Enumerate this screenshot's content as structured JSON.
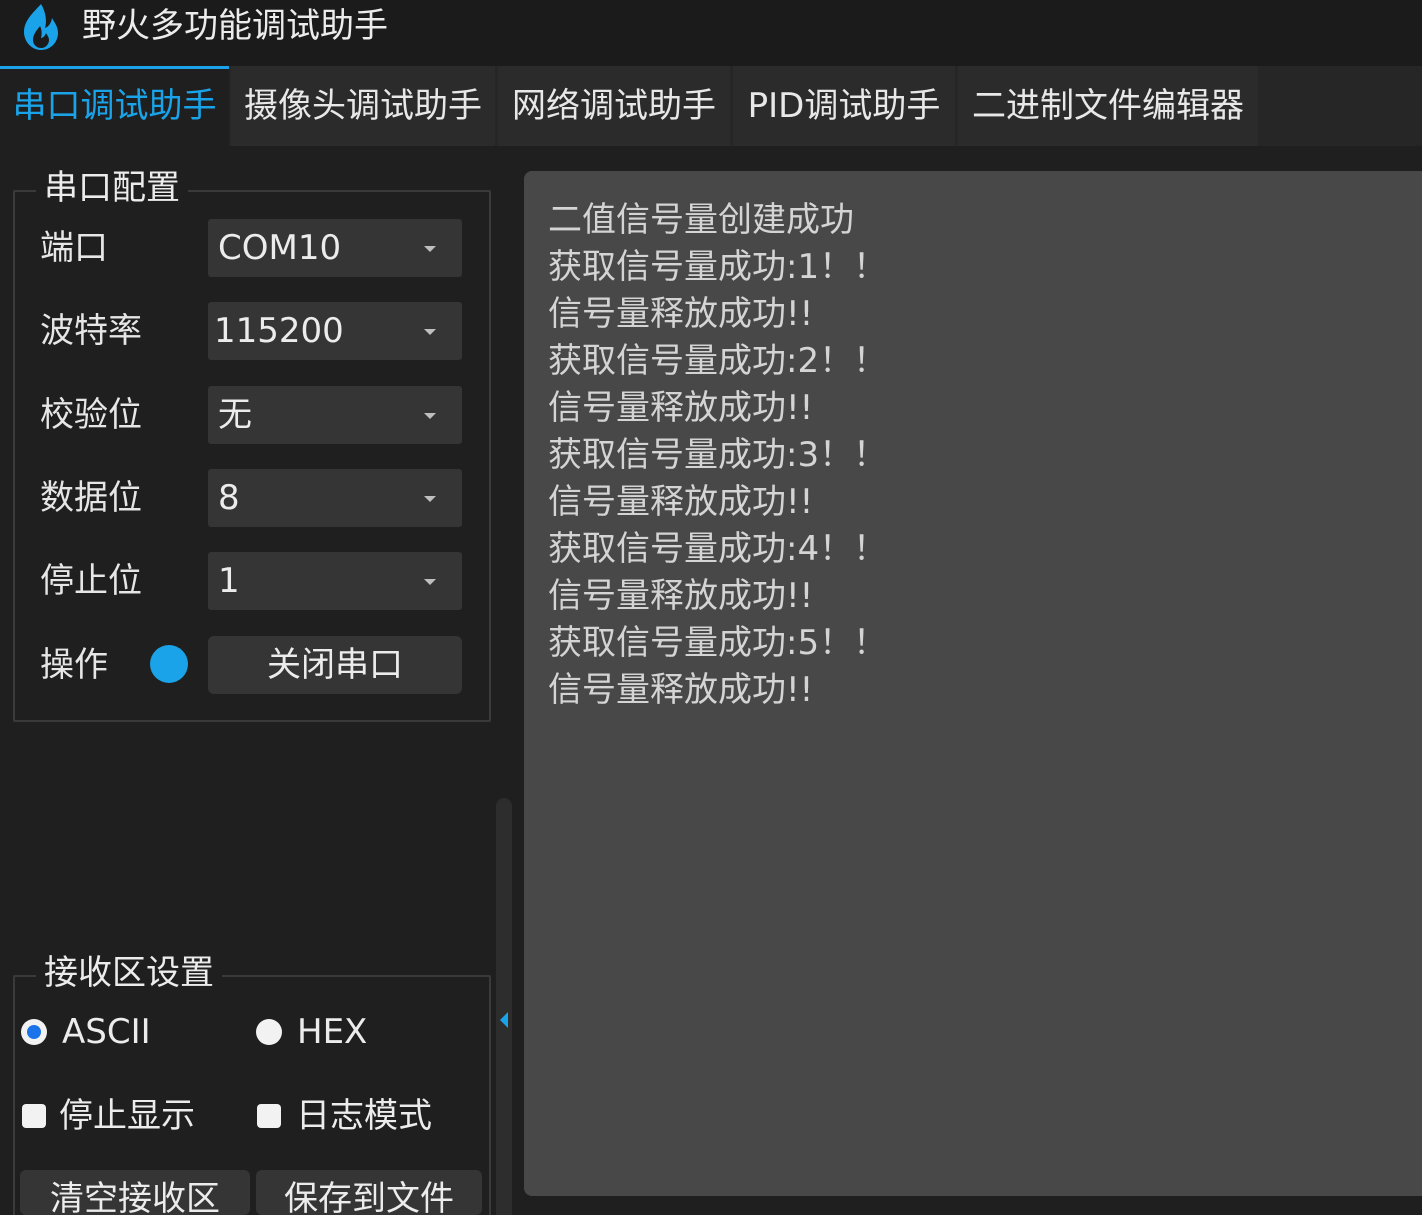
{
  "app": {
    "title": "野火多功能调试助手",
    "icon": "flame-icon",
    "accent_color": "#1aa3e8"
  },
  "tabs": [
    {
      "label": "串口调试助手",
      "active": true
    },
    {
      "label": "摄像头调试助手",
      "active": false
    },
    {
      "label": "网络调试助手",
      "active": false
    },
    {
      "label": "PID调试助手",
      "active": false
    },
    {
      "label": "二进制文件编辑器",
      "active": false
    }
  ],
  "serial_config": {
    "title": "串口配置",
    "rows": [
      {
        "label": "端口",
        "value": "COM10"
      },
      {
        "label": "波特率",
        "value": "115200"
      },
      {
        "label": "校验位",
        "value": "无"
      },
      {
        "label": "数据位",
        "value": "8"
      },
      {
        "label": "停止位",
        "value": "1"
      }
    ],
    "operation_label": "操作",
    "status_color": "#1aa3e8",
    "close_button": "关闭串口"
  },
  "receive_settings": {
    "title": "接收区设置",
    "options": {
      "ascii": "ASCII",
      "hex": "HEX",
      "selected": "ascii"
    },
    "stop_display": "停止显示",
    "log_mode": "日志模式",
    "clear_button": "清空接收区",
    "save_button": "保存到文件"
  },
  "receive_area": {
    "lines": [
      "二值信号量创建成功",
      "获取信号量成功:1！！",
      "信号量释放成功!!",
      "获取信号量成功:2！！",
      "信号量释放成功!!",
      "获取信号量成功:3！！",
      "信号量释放成功!!",
      "获取信号量成功:4！！",
      "信号量释放成功!!",
      "获取信号量成功:5！！",
      "信号量释放成功!!"
    ]
  }
}
